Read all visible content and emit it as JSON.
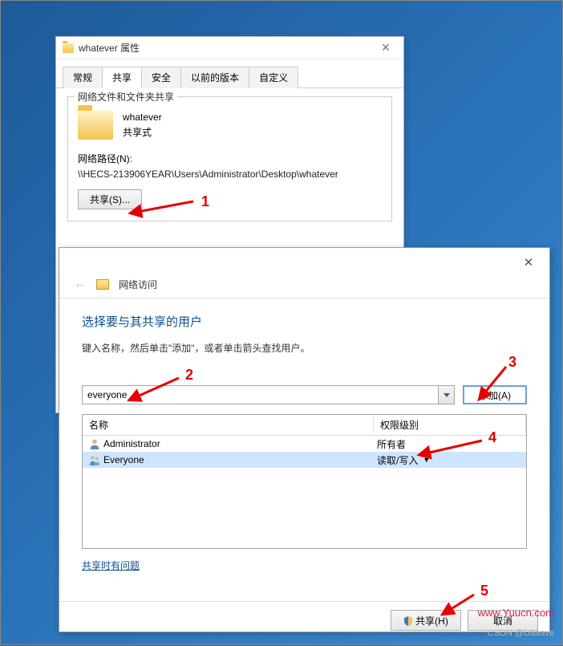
{
  "prop_window": {
    "title": "whatever 属性",
    "tabs": [
      "常规",
      "共享",
      "安全",
      "以前的版本",
      "自定义"
    ],
    "active_tab": 1,
    "group_title": "网络文件和文件夹共享",
    "folder_name": "whatever",
    "share_status": "共享式",
    "net_path_label": "网络路径(N):",
    "net_path": "\\\\HECS-213906YEAR\\Users\\Administrator\\Desktop\\whatever",
    "share_btn": "共享(S)..."
  },
  "access_dialog": {
    "crumb": "网络访问",
    "heading": "选择要与其共享的用户",
    "instruction": "键入名称，然后单击\"添加\"，或者单击箭头查找用户。",
    "input_value": "everyone",
    "add_btn": "添加(A)",
    "cols": {
      "name": "名称",
      "perm": "权限级别"
    },
    "rows": [
      {
        "icon": "user",
        "name": "Administrator",
        "perm": "所有者",
        "dropdown": false
      },
      {
        "icon": "group",
        "name": "Everyone",
        "perm": "读取/写入",
        "dropdown": true,
        "selected": true
      }
    ],
    "trouble_link": "共享时有问题",
    "share_btn": "共享(H)",
    "cancel_btn": "取消"
  },
  "annotations": [
    "1",
    "2",
    "3",
    "4",
    "5"
  ],
  "watermark": "www.Yuucn.com",
  "csdn": "CSDN @Daaave"
}
